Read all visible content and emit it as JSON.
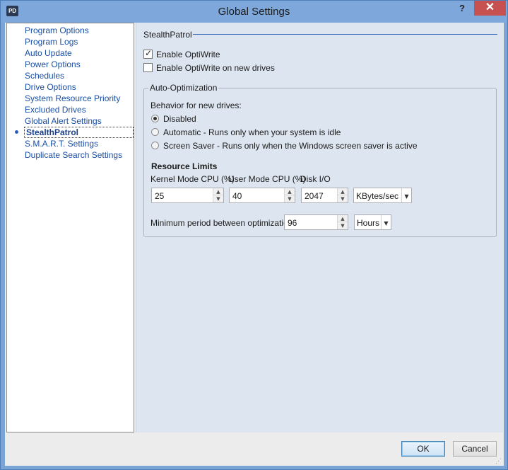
{
  "window": {
    "title": "Global Settings",
    "app_icon_text": "PD",
    "help_label": "?",
    "close_label": "✕"
  },
  "nav": {
    "items": [
      {
        "label": "Program Options"
      },
      {
        "label": "Program Logs"
      },
      {
        "label": "Auto Update"
      },
      {
        "label": "Power Options"
      },
      {
        "label": "Schedules"
      },
      {
        "label": "Drive Options"
      },
      {
        "label": "System Resource Priority"
      },
      {
        "label": "Excluded Drives"
      },
      {
        "label": "Global Alert Settings"
      },
      {
        "label": "StealthPatrol",
        "selected": true
      },
      {
        "label": "S.M.A.R.T. Settings"
      },
      {
        "label": "Duplicate Search Settings"
      }
    ]
  },
  "pane": {
    "section_title": "StealthPatrol",
    "enable_optiwrite": {
      "label": "Enable OptiWrite",
      "checked": true
    },
    "enable_optiwrite_new": {
      "label": "Enable OptiWrite on new drives",
      "checked": false
    },
    "auto_opt": {
      "group_title": "Auto-Optimization",
      "behavior_label": "Behavior for new drives:",
      "options": [
        {
          "label": "Disabled",
          "selected": true
        },
        {
          "label": "Automatic - Runs only when your system is idle",
          "selected": false
        },
        {
          "label": "Screen Saver - Runs only when the Windows screen saver is active",
          "selected": false
        }
      ],
      "resource_limits_title": "Resource Limits",
      "kernel_label": "Kernel Mode CPU (%)",
      "user_label": "User Mode CPU (%)",
      "disk_label": "Disk I/O",
      "kernel_value": "25",
      "user_value": "40",
      "disk_value": "2047",
      "disk_unit": "KBytes/sec",
      "min_period_label": "Minimum period between optimizations",
      "min_period_value": "96",
      "min_period_unit": "Hours"
    }
  },
  "footer": {
    "ok_label": "OK",
    "cancel_label": "Cancel"
  },
  "colors": {
    "title_bar": "#7ea8dc",
    "close_button": "#c75050",
    "nav_link": "#1a4fa3",
    "pane_bg": "#dde6f0",
    "section_line": "#3568b8"
  },
  "icons": {
    "spin_up": "▲",
    "spin_down": "▼",
    "dropdown": "▼"
  }
}
